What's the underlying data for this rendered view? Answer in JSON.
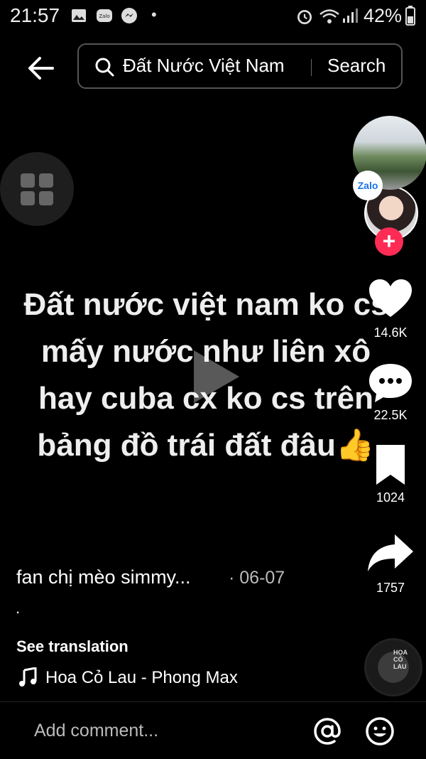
{
  "status_bar": {
    "time": "21:57",
    "battery": "42%",
    "notification_icons": [
      "gallery-icon",
      "zalo-icon",
      "messenger-icon"
    ]
  },
  "search": {
    "query": "Đất Nước Việt Nam",
    "button_label": "Search"
  },
  "video": {
    "caption_lines": [
      "Đất nước việt nam ko cs",
      "mấy nước như liên xô",
      "hay cuba cx ko cs trên",
      "bảng đồ trái đất đâu👍"
    ]
  },
  "rail": {
    "bubble_app": "Zalo",
    "likes": "14.6K",
    "comments": "22.5K",
    "saves": "1024",
    "shares": "1757"
  },
  "post": {
    "author": "fan chị mèo simmy...",
    "date": "· 06-07",
    "description": ".",
    "see_translation": "See translation",
    "music": "Hoa Cỏ Lau - Phong Max",
    "disc_label": "HOA\nCỎ\nLAU"
  },
  "comment_bar": {
    "placeholder": "Add comment..."
  },
  "colors": {
    "background": "#000000",
    "follow_accent": "#fe2c55",
    "text": "#ffffff"
  }
}
